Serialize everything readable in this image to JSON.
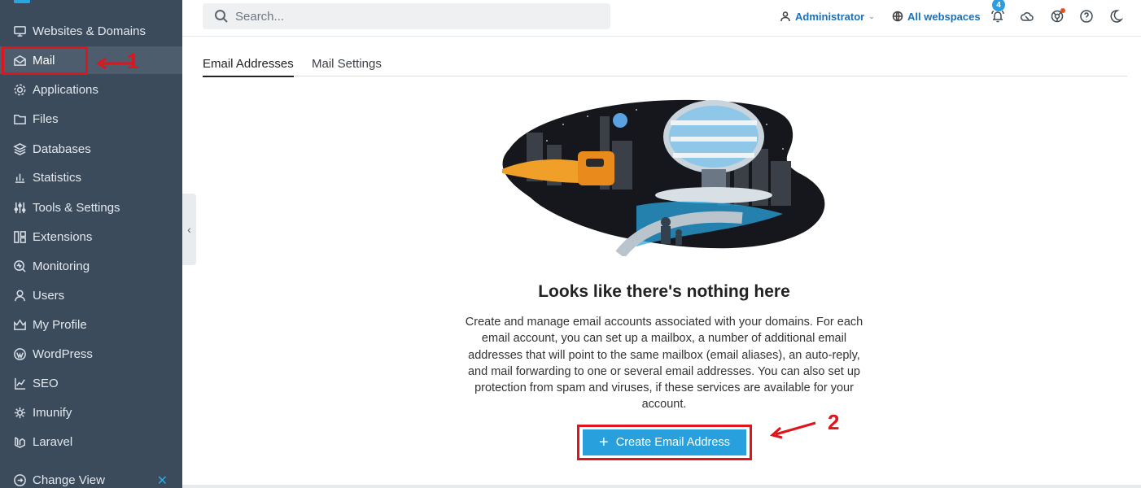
{
  "sidebar": {
    "items": [
      {
        "label": "Websites & Domains",
        "icon": "monitor-icon"
      },
      {
        "label": "Mail",
        "icon": "mail-icon",
        "active": true
      },
      {
        "label": "Applications",
        "icon": "gear-icon"
      },
      {
        "label": "Files",
        "icon": "folder-icon"
      },
      {
        "label": "Databases",
        "icon": "database-icon"
      },
      {
        "label": "Statistics",
        "icon": "bar-chart-icon"
      },
      {
        "label": "Tools & Settings",
        "icon": "sliders-icon"
      },
      {
        "label": "Extensions",
        "icon": "grid-icon"
      },
      {
        "label": "Monitoring",
        "icon": "monitoring-icon"
      },
      {
        "label": "Users",
        "icon": "user-icon"
      },
      {
        "label": "My Profile",
        "icon": "profile-icon"
      },
      {
        "label": "WordPress",
        "icon": "wordpress-icon"
      },
      {
        "label": "SEO",
        "icon": "seo-icon"
      },
      {
        "label": "Imunify",
        "icon": "imunify-icon"
      },
      {
        "label": "Laravel",
        "icon": "laravel-icon"
      }
    ],
    "change_view": "Change View"
  },
  "header": {
    "search_placeholder": "Search...",
    "user": "Administrator",
    "webspaces": "All webspaces",
    "notifications_count": "4"
  },
  "tabs": [
    "Email Addresses",
    "Mail Settings"
  ],
  "main": {
    "empty_title": "Looks like there's nothing here",
    "empty_description": "Create and manage email accounts associated with your domains. For each email account, you can set up a mailbox, a number of additional email addresses that will point to the same mailbox (email aliases), an auto-reply, and mail forwarding to one or several email addresses. You can also set up protection from spam and viruses, if these services are available for your account.",
    "create_button": "Create Email Address"
  },
  "annotations": {
    "step1": "1",
    "step2": "2"
  },
  "colors": {
    "sidebar_bg": "#3c4b5c",
    "accent": "#27a0dd",
    "annotation_red": "#e0141b"
  }
}
